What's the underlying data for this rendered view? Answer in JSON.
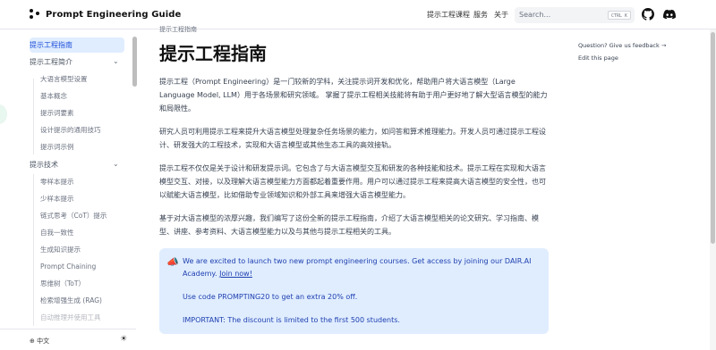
{
  "header": {
    "logo_text": "Prompt Engineering Guide",
    "nav": [
      "提示工程课程",
      "服务",
      "关于"
    ],
    "search_placeholder": "Search...",
    "search_shortcut": "CTRL K"
  },
  "sidebar": {
    "items": [
      {
        "label": "提示工程指南",
        "level": 0,
        "active": true
      },
      {
        "label": "提示工程简介",
        "level": 0,
        "expandable": true
      },
      {
        "label": "大语言模型设置",
        "level": 1
      },
      {
        "label": "基本概念",
        "level": 1
      },
      {
        "label": "提示词要素",
        "level": 1
      },
      {
        "label": "设计提示的通用技巧",
        "level": 1
      },
      {
        "label": "提示词示例",
        "level": 1
      },
      {
        "label": "提示技术",
        "level": 0,
        "expandable": true
      },
      {
        "label": "零样本提示",
        "level": 1
      },
      {
        "label": "少样本提示",
        "level": 1
      },
      {
        "label": "链式思考（CoT）提示",
        "level": 1
      },
      {
        "label": "自我一致性",
        "level": 1
      },
      {
        "label": "生成知识提示",
        "level": 1
      },
      {
        "label": "Prompt Chaining",
        "level": 1
      },
      {
        "label": "思维树（ToT）",
        "level": 1
      },
      {
        "label": "检索增强生成 (RAG)",
        "level": 1
      },
      {
        "label": "自动推理并使用工具",
        "level": 1
      }
    ],
    "language": "中文"
  },
  "main": {
    "breadcrumb": "提示工程指南",
    "title": "提示工程指南",
    "paragraphs": [
      "提示工程（Prompt Engineering）是一门较新的学科，关注提示词开发和优化，帮助用户将大语言模型（Large Language Model, LLM）用于各场景和研究领域。 掌握了提示工程相关技能将有助于用户更好地了解大型语言模型的能力和局限性。",
      "研究人员可利用提示工程来提升大语言模型处理复杂任务场景的能力，如问答和算术推理能力。开发人员可通过提示工程设计、研发强大的工程技术，实现和大语言模型或其他生态工具的高效接轨。",
      "提示工程不仅仅是关于设计和研发提示词。它包含了与大语言模型交互和研发的各种技能和技术。提示工程在实现和大语言模型交互、对接，以及理解大语言模型能力方面都起着重要作用。用户可以通过提示工程来提高大语言模型的安全性，也可以赋能大语言模型，比如借助专业领域知识和外部工具来增强大语言模型能力。",
      "基于对大语言模型的浓厚兴趣，我们编写了这份全新的提示工程指南，介绍了大语言模型相关的论文研究、学习指南、模型、讲座、参考资料、大语言模型能力以及与其他与提示工程相关的工具。"
    ],
    "callout": {
      "icon": "📣",
      "line1": "We are excited to launch two new prompt engineering courses. Get access by joining our DAIR.AI Academy.",
      "link": "Join now!",
      "line2": "Use code PROMPTING20 to get an extra 20% off.",
      "line3": "IMPORTANT: The discount is limited to the first 500 students."
    }
  },
  "toc": {
    "feedback": "Question? Give us feedback →",
    "edit": "Edit this page"
  }
}
